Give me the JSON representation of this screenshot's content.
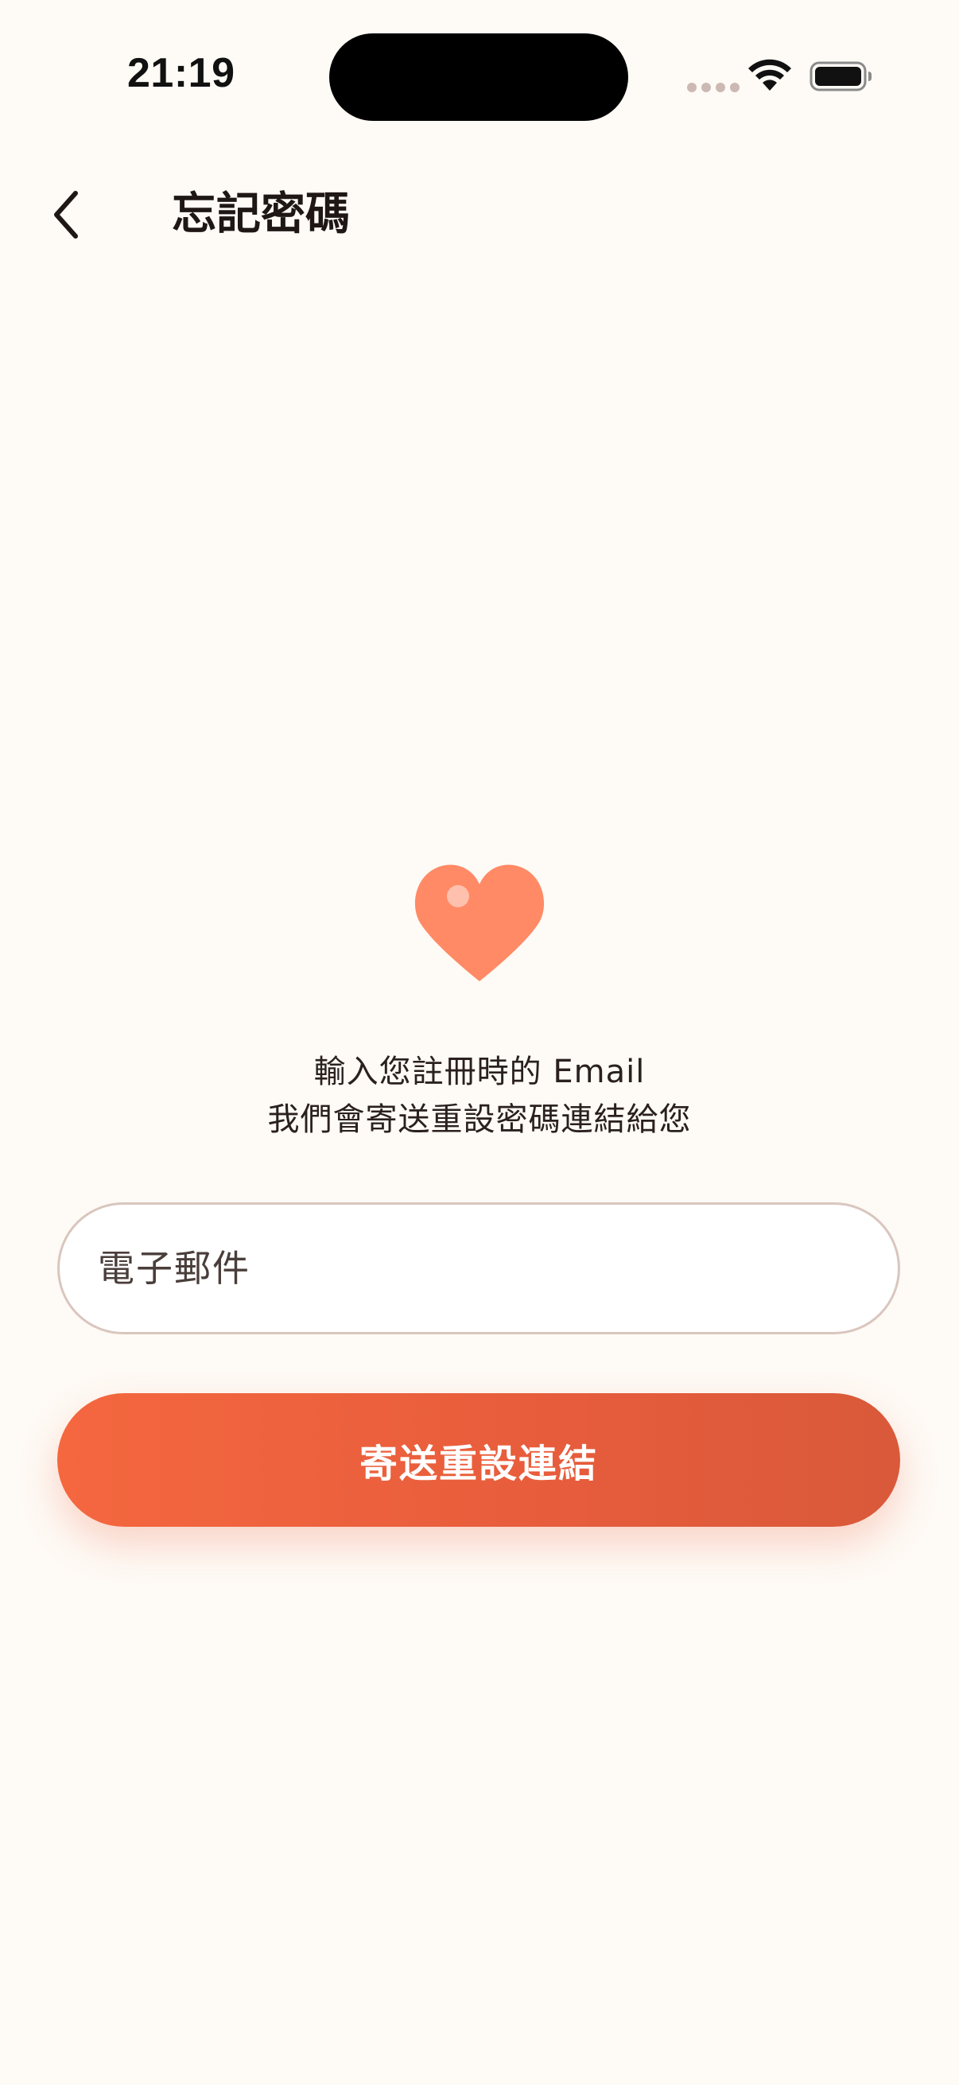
{
  "status_bar": {
    "time": "21:19"
  },
  "nav": {
    "title": "忘記密碼",
    "back_icon": "chevron-left-icon"
  },
  "main": {
    "heart_icon": "heart-icon",
    "heart_color": "#FF8A65",
    "intro_line_1": "輸入您註冊時的 Email",
    "intro_line_2": "我們會寄送重設密碼連結給您",
    "email_placeholder": "電子郵件",
    "email_value": "",
    "send_label": "寄送重設連結"
  },
  "colors": {
    "background": "#FEFAF5",
    "accent": "#EE6440",
    "field_border": "#D9C6BE"
  }
}
